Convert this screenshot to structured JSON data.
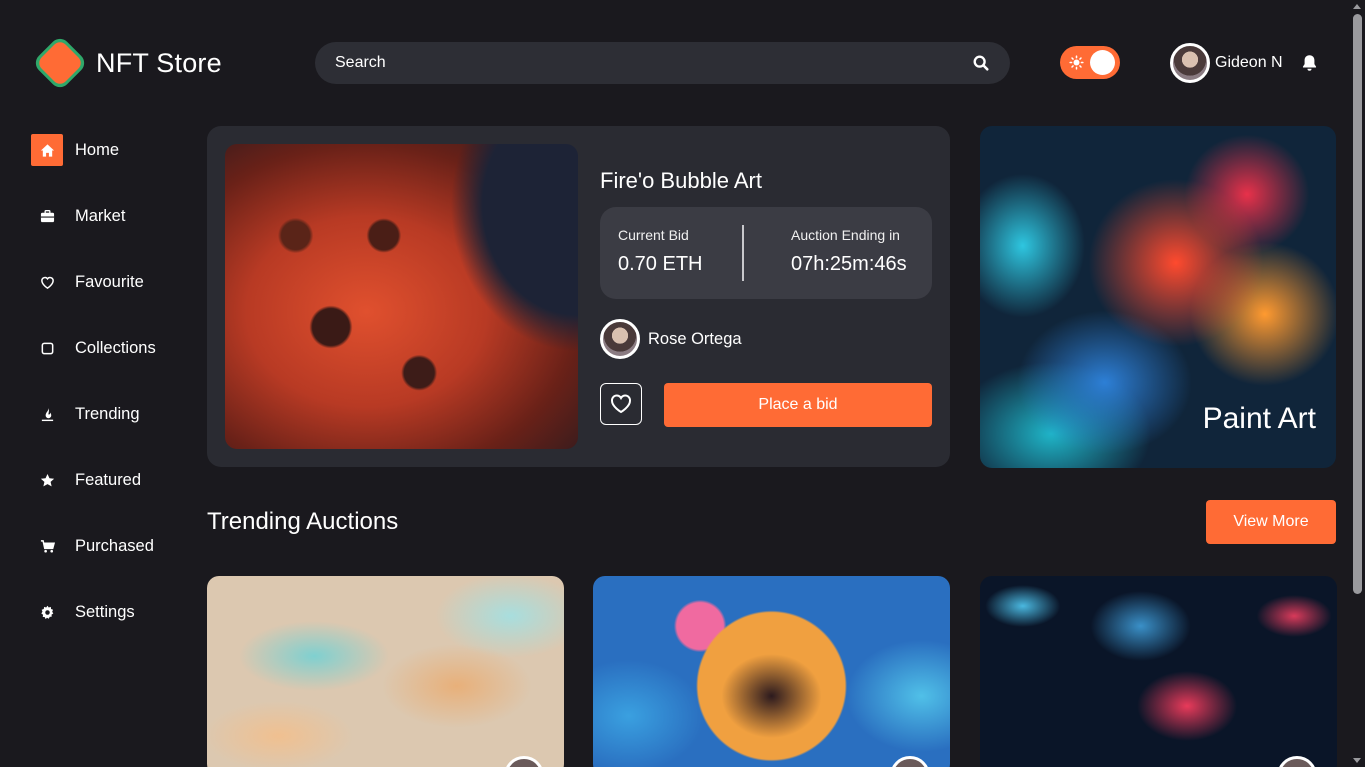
{
  "header": {
    "logo_text": "NFT Store",
    "search_placeholder": "Search",
    "theme_toggle_state": "on",
    "user_name": "Gideon N"
  },
  "sidebar": {
    "items": [
      {
        "label": "Home",
        "icon": "home-icon",
        "active": true
      },
      {
        "label": "Market",
        "icon": "briefcase-icon",
        "active": false
      },
      {
        "label": "Favourite",
        "icon": "heart-icon",
        "active": false
      },
      {
        "label": "Collections",
        "icon": "square-icon",
        "active": false
      },
      {
        "label": "Trending",
        "icon": "flame-icon",
        "active": false
      },
      {
        "label": "Featured",
        "icon": "star-icon",
        "active": false
      },
      {
        "label": "Purchased",
        "icon": "cart-icon",
        "active": false
      },
      {
        "label": "Settings",
        "icon": "gear-icon",
        "active": false
      }
    ]
  },
  "hero": {
    "title": "Fire'o Bubble Art",
    "current_bid_label": "Current Bid",
    "current_bid_value": "0.70 ETH",
    "auction_label": "Auction Ending in",
    "auction_value": "07h:25m:46s",
    "owner_name": "Rose Ortega",
    "place_bid_label": "Place a bid"
  },
  "side_card": {
    "label": "Paint Art"
  },
  "trending": {
    "title": "Trending Auctions",
    "view_more_label": "View More"
  },
  "colors": {
    "accent": "#ff6b35",
    "background": "#1a191e",
    "card": "#2a2b32",
    "logo_green": "#2fa86a"
  }
}
